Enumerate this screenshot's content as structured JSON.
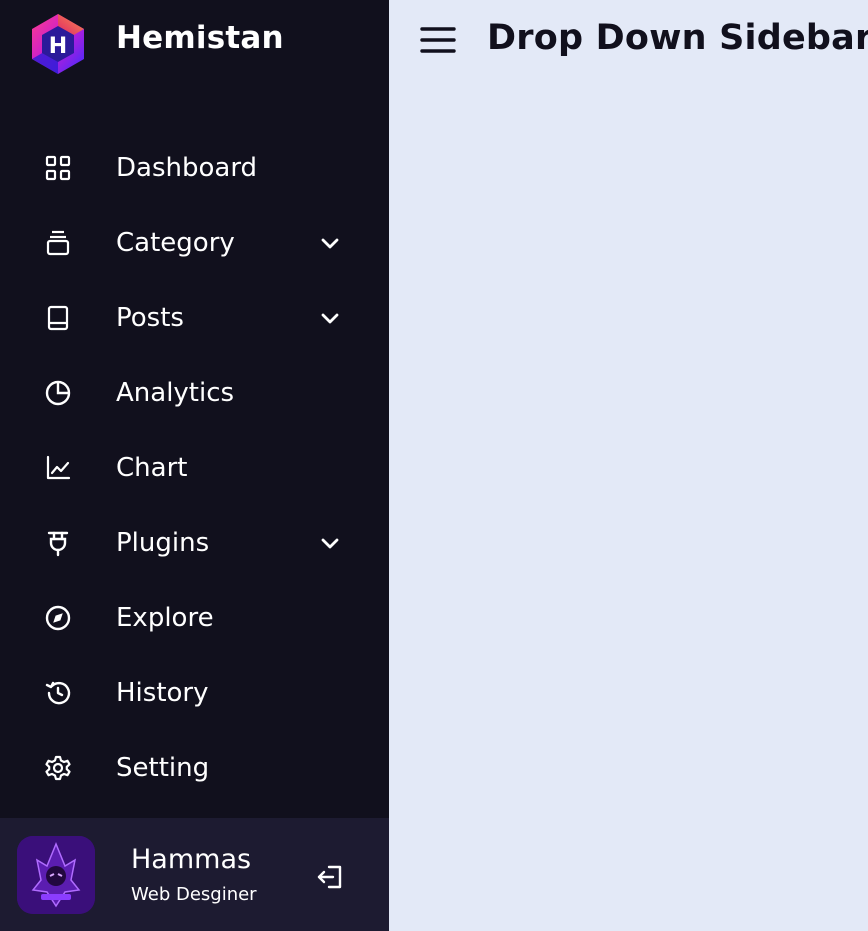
{
  "brand": {
    "name": "Hemistan",
    "logo_letter": "H",
    "logo_icon": "hexagon-logo-icon"
  },
  "nav": {
    "items": [
      {
        "label": "Dashboard",
        "icon": "grid-icon",
        "has_dropdown": false
      },
      {
        "label": "Category",
        "icon": "collection-icon",
        "has_dropdown": true
      },
      {
        "label": "Posts",
        "icon": "book-icon",
        "has_dropdown": true
      },
      {
        "label": "Analytics",
        "icon": "pie-chart-icon",
        "has_dropdown": false
      },
      {
        "label": "Chart",
        "icon": "line-chart-icon",
        "has_dropdown": false
      },
      {
        "label": "Plugins",
        "icon": "plug-icon",
        "has_dropdown": true
      },
      {
        "label": "Explore",
        "icon": "compass-icon",
        "has_dropdown": false
      },
      {
        "label": "History",
        "icon": "history-icon",
        "has_dropdown": false
      },
      {
        "label": "Setting",
        "icon": "gear-icon",
        "has_dropdown": false
      }
    ]
  },
  "profile": {
    "name": "Hammas",
    "job": "Web Desginer",
    "logout_icon": "logout-icon"
  },
  "header": {
    "menu_icon": "hamburger-menu-icon",
    "title": "Drop Down Sidebar"
  },
  "colors": {
    "sidebar_bg": "#11101d",
    "profile_bg": "#1d1b31",
    "content_bg": "#e3e9f7",
    "text_light": "#ffffff",
    "text_dark": "#11101d"
  }
}
